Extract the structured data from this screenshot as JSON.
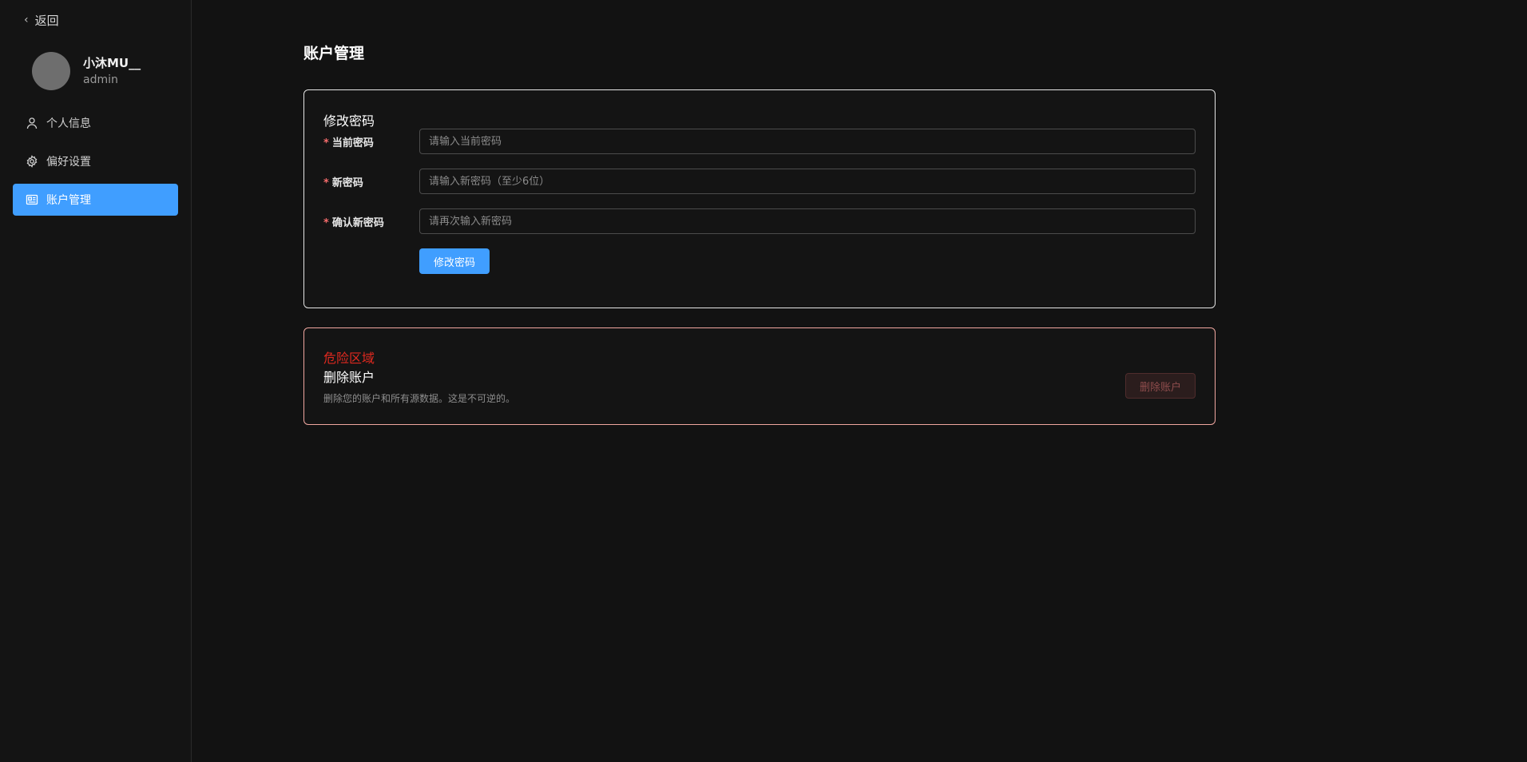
{
  "sidebar": {
    "back_label": "返回",
    "user": {
      "name": "小沐MU__",
      "role": "admin"
    },
    "items": [
      {
        "label": "个人信息",
        "icon": "user-icon",
        "active": false
      },
      {
        "label": "偏好设置",
        "icon": "gear-icon",
        "active": false
      },
      {
        "label": "账户管理",
        "icon": "id-card-icon",
        "active": true
      }
    ]
  },
  "main": {
    "page_title": "账户管理",
    "password_card": {
      "title": "修改密码",
      "required_mark": "*",
      "fields": [
        {
          "label": "当前密码",
          "value": "",
          "placeholder": "请输入当前密码"
        },
        {
          "label": "新密码",
          "value": "",
          "placeholder": "请输入新密码（至少6位）"
        },
        {
          "label": "确认新密码",
          "value": "",
          "placeholder": "请再次输入新密码"
        }
      ],
      "submit_label": "修改密码"
    },
    "danger_zone": {
      "title": "危险区域",
      "delete_title": "删除账户",
      "delete_desc": "删除您的账户和所有源数据。这是不可逆的。",
      "delete_button": "删除账户"
    }
  },
  "colors": {
    "background": "#121212",
    "accent": "#409eff",
    "danger": "#e0291f",
    "danger_border": "#f0a7a0"
  }
}
